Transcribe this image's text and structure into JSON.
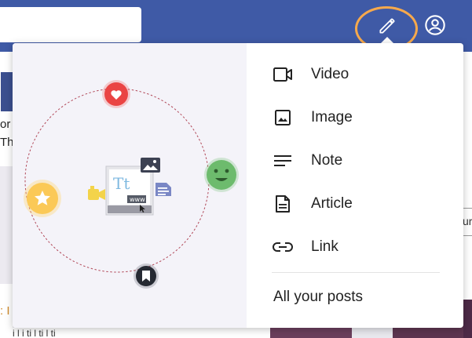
{
  "background": {
    "left_text_line1": "or",
    "left_text_line2": "The",
    "right_input_value": "ur",
    "bottom_left_text": ": I",
    "bottom_line_text": "i   l   i ti   l ti   l ti",
    "bottom_right_text": "pr"
  },
  "header": {
    "pencil_icon": "pencil-icon",
    "account_icon": "account-circle-icon",
    "accent_color": "#3f5aa6",
    "highlight_color": "#f7a94c"
  },
  "create_menu": {
    "items": [
      {
        "label": "Video",
        "icon": "video-camera-icon"
      },
      {
        "label": "Image",
        "icon": "image-icon"
      },
      {
        "label": "Note",
        "icon": "note-lines-icon"
      },
      {
        "label": "Article",
        "icon": "article-document-icon"
      },
      {
        "label": "Link",
        "icon": "link-icon"
      }
    ],
    "all_posts_label": "All your posts"
  },
  "illustration": {
    "doc_text": "Tt",
    "doc_badge": "www"
  }
}
